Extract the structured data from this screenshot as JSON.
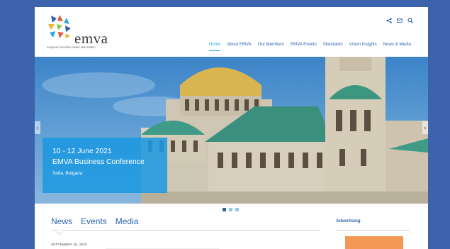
{
  "brand": {
    "logo_word": "emva",
    "logo_tagline": "european machine vision association"
  },
  "utility_icons": [
    "share-icon",
    "mail-icon",
    "search-icon"
  ],
  "nav": {
    "items": [
      {
        "label": "Home",
        "active": true
      },
      {
        "label": "About EMVA",
        "active": false
      },
      {
        "label": "Our Members",
        "active": false
      },
      {
        "label": "EMVA Events",
        "active": false
      },
      {
        "label": "Standards",
        "active": false
      },
      {
        "label": "Vision Insights",
        "active": false
      },
      {
        "label": "News & Media",
        "active": false
      }
    ]
  },
  "hero": {
    "date": "10 - 12 June 2021",
    "title": "EMVA Business Conference",
    "place": "Sofia, Bulgaria",
    "slides": 3,
    "active_slide": 1
  },
  "content": {
    "tabs": [
      "News",
      "Events",
      "Media"
    ],
    "first_post_date": "SEPTEMBER 28, 2020"
  },
  "sidebar": {
    "heading": "Advertising"
  },
  "colors": {
    "background": "#3e63ad",
    "brand_blue": "#2f63b0",
    "accent": "#29a8e0",
    "caption_bg": "#1e98e0",
    "ad_orange": "#f29a55"
  }
}
